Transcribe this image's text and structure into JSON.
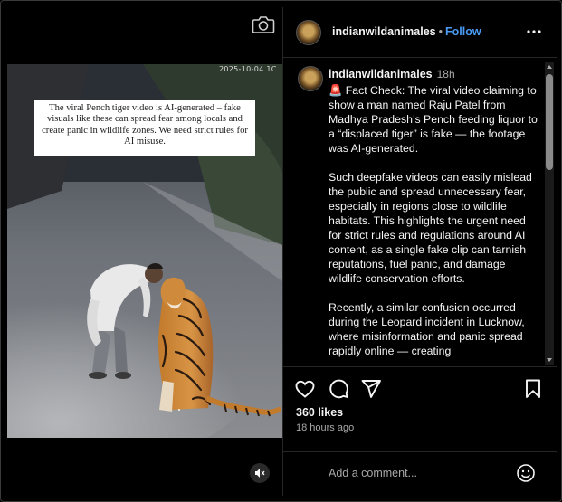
{
  "media": {
    "timestamp": "2025-10-04  1C",
    "caption": "The viral Pench tiger video is AI-generated – fake visuals like these can spread fear among locals and create panic in wildlife zones.  We need strict rules for AI misuse.",
    "camera_icon": "camera-icon",
    "mute_icon": "speaker-muted-icon"
  },
  "header": {
    "username": "indianwildanimales",
    "separator": "•",
    "follow_label": "Follow",
    "more_icon": "more-options-icon"
  },
  "post": {
    "username": "indianwildanimales",
    "time": "18h",
    "text": "🚨 Fact Check: The viral video claiming to show a man named Raju Patel from Madhya Pradesh’s Pench feeding liquor to a “displaced tiger” is fake — the footage was AI-generated.\n\nSuch deepfake videos can easily mislead the public and spread unnecessary fear, especially in regions close to wildlife habitats. This highlights the urgent need for strict rules and regulations around AI content, as a single fake clip can tarnish reputations, fuel panic, and damage wildlife conservation efforts.\n\nRecently, a similar confusion occurred during the Leopard incident in Lucknow, where misinformation and panic spread rapidly online — creating"
  },
  "actions": {
    "like_icon": "heart-icon",
    "comment_icon": "comment-icon",
    "share_icon": "share-icon",
    "save_icon": "bookmark-icon",
    "likes": "360 likes",
    "posted_ago": "18 hours ago"
  },
  "comment_box": {
    "placeholder": "Add a comment...",
    "emoji_icon": "emoji-icon"
  },
  "colors": {
    "background": "#000000",
    "text": "#f5f5f5",
    "muted": "#a8a8a8",
    "link": "#4a9bf5",
    "alert": "#e0245e"
  }
}
